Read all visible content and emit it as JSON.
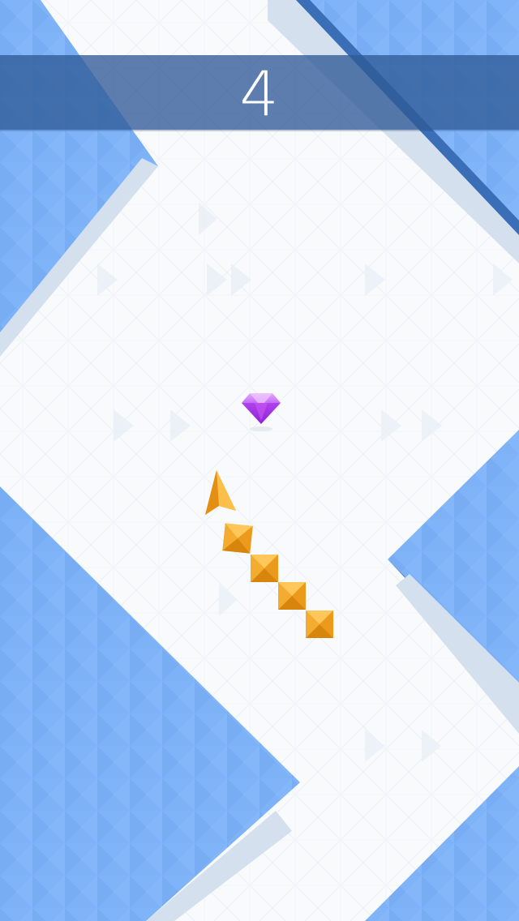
{
  "hud": {
    "score": "4"
  },
  "gem": {
    "icon": "diamond-icon",
    "color": "#b44ef0"
  },
  "player": {
    "head_icon": "arrow-head-icon",
    "segment_icon": "pyramid-block-icon",
    "tail_segments": 4,
    "color": "#f5a623"
  },
  "theme": {
    "wall_color": "#7db2f7",
    "wall_edge_color": "#3a6fb8",
    "floor_color": "#f8fafc",
    "wall_lip_color": "#d5e0ee",
    "score_bar_color": "#2f5a96"
  }
}
